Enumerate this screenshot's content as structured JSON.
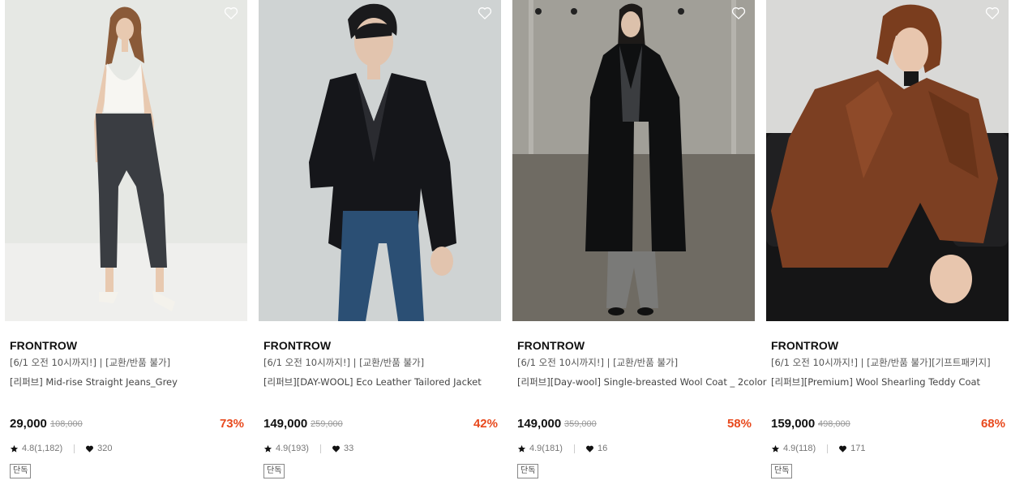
{
  "colors": {
    "discount": "#e8491d",
    "strike_price": "#999999",
    "text_primary": "#111111"
  },
  "products": [
    {
      "brand": "FRONTROW",
      "promo": "[6/1 오전 10시까지!] | [교환/반품 불가]",
      "name": "[리퍼브] Mid-rise Straight Jeans_Grey",
      "price": "29,000",
      "original_price": "108,000",
      "discount": "73%",
      "rating": "4.8(1,182)",
      "likes": "320",
      "badge": "단독",
      "wish_icon": "heart-outline-icon"
    },
    {
      "brand": "FRONTROW",
      "promo": "[6/1 오전 10시까지!] | [교환/반품 불가]",
      "name": "[리퍼브][DAY-WOOL] Eco Leather Tailored Jacket",
      "price": "149,000",
      "original_price": "259,000",
      "discount": "42%",
      "rating": "4.9(193)",
      "likes": "33",
      "badge": "단독",
      "wish_icon": "heart-outline-icon"
    },
    {
      "brand": "FRONTROW",
      "promo": "[6/1 오전 10시까지!] | [교환/반품 불가]",
      "name": "[리퍼브][Day-wool] Single-breasted Wool Coat _ 2color",
      "price": "149,000",
      "original_price": "359,000",
      "discount": "58%",
      "rating": "4.9(181)",
      "likes": "16",
      "badge": "단독",
      "wish_icon": "heart-outline-icon"
    },
    {
      "brand": "FRONTROW",
      "promo": "[6/1 오전 10시까지!] | [교환/반품 불가][기프트패키지]",
      "name": "[리퍼브][Premium] Wool Shearling Teddy Coat",
      "price": "159,000",
      "original_price": "498,000",
      "discount": "68%",
      "rating": "4.9(118)",
      "likes": "171",
      "badge": "단독",
      "wish_icon": "heart-outline-icon"
    }
  ]
}
